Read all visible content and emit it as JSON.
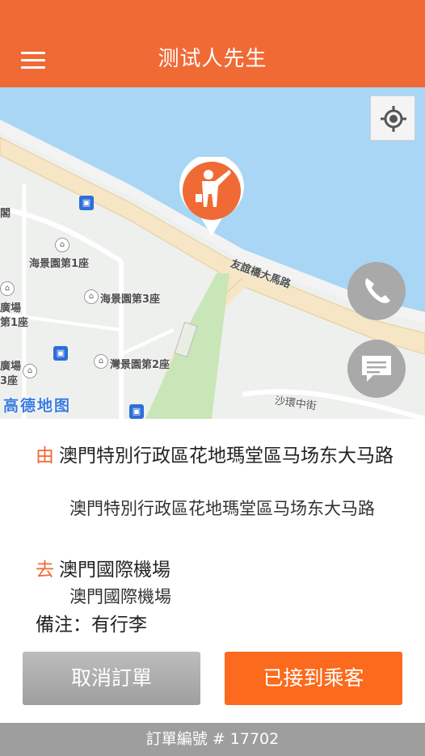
{
  "header": {
    "title": "测试人先生"
  },
  "map": {
    "labels": {
      "road": "友誼橋大馬路",
      "building1": "海景園第1座",
      "building3": "海景園第3座",
      "building2": "灣景園第2座",
      "left_partial1": "閣",
      "left_partial2": "廣場",
      "left_partial3": "第1座",
      "left_partial4": "廣場",
      "left_partial5": "3座",
      "street": "沙環中街",
      "logo": "高德地图"
    },
    "colors": {
      "water": "#a8d6f4",
      "land": "#eef0ee",
      "road": "#f6e6c5",
      "park": "#c9e6b8"
    }
  },
  "order": {
    "from_tag": "由",
    "from_main": "澳門特別行政區花地瑪堂區马场东大马路",
    "from_detail": "澳門特別行政區花地瑪堂區马场东大马路",
    "to_tag": "去",
    "to_main": "澳門國際機場",
    "to_detail": "澳門國際機場",
    "note": "備注：有行李"
  },
  "actions": {
    "cancel_label": "取消訂單",
    "pickup_label": "已接到乘客"
  },
  "footer": {
    "order_number": "訂單編號 # 17702"
  },
  "theme": {
    "accent": "#f06a35",
    "button_orange": "#fb6a1d",
    "button_gray": "#a9a9a9"
  }
}
